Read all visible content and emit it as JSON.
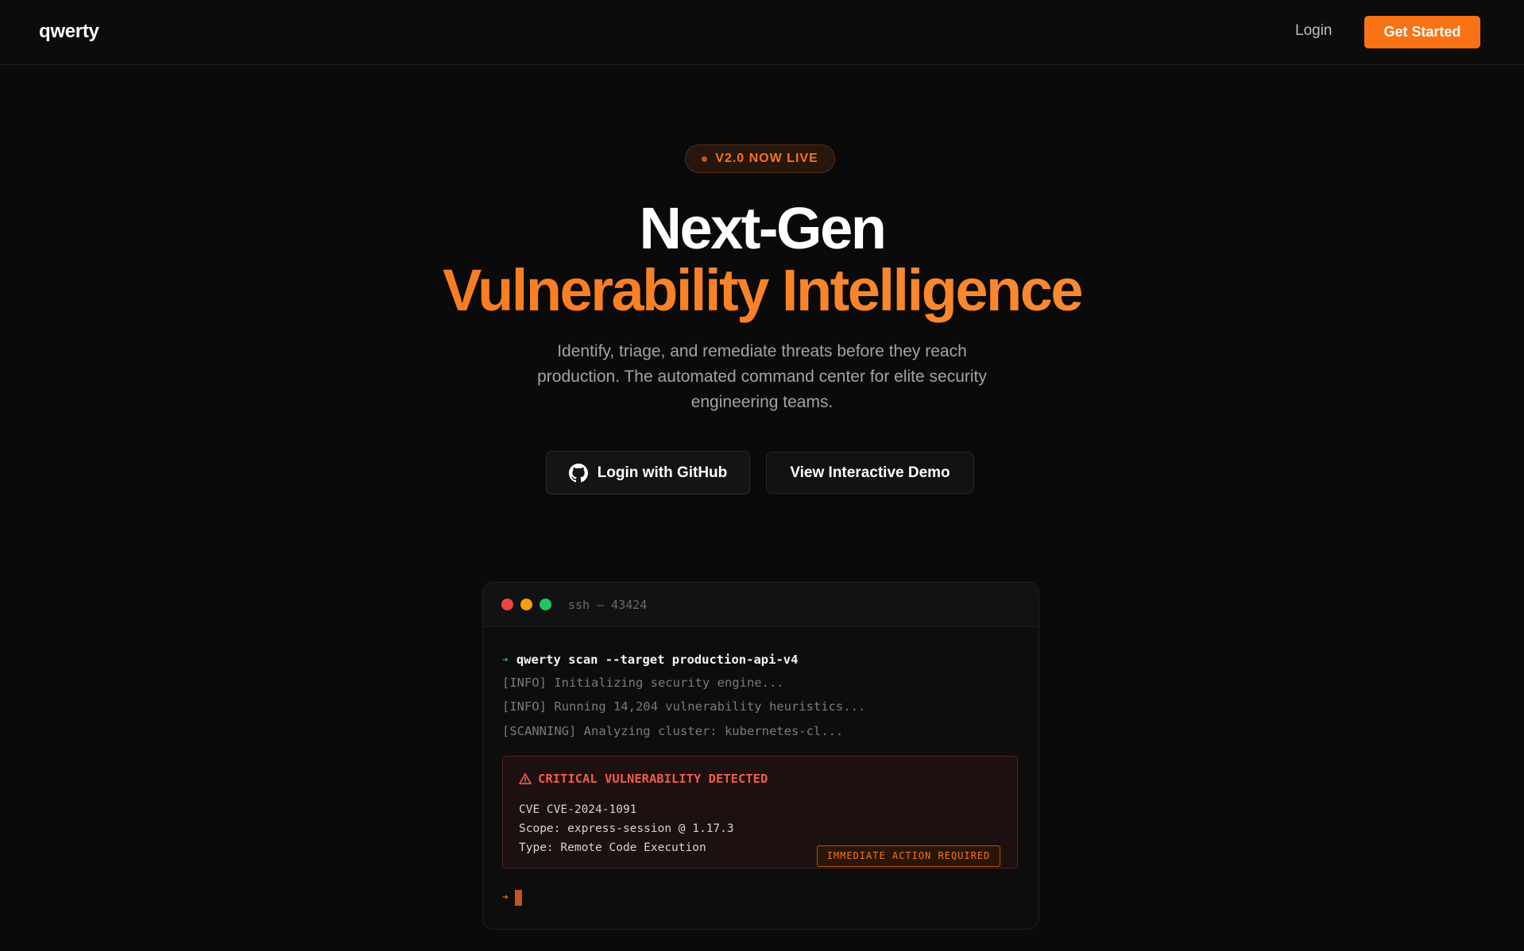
{
  "nav": {
    "logo": "qwerty",
    "login": "Login",
    "get_started": "Get Started"
  },
  "hero": {
    "badge": "V2.0 NOW LIVE",
    "title_line1": "Next-Gen",
    "title_line2": "Vulnerability Intelligence",
    "subtitle": "Identify, triage, and remediate threats before they reach production. The automated command center for elite security engineering teams.",
    "github_button": "Login with GitHub",
    "demo_button": "View Interactive Demo"
  },
  "terminal": {
    "title": "ssh — 43424",
    "prompt_symbol": "➔",
    "command": "qwerty scan --target production-api-v4",
    "logs": [
      "[INFO] Initializing security engine...",
      "[INFO] Running 14,204 vulnerability heuristics...",
      "[SCANNING] Analyzing cluster: kubernetes-cl..."
    ],
    "alert": {
      "title": "CRITICAL VULNERABILITY DETECTED",
      "lines": [
        "CVE CVE-2024-1091",
        "Scope: express-session @ 1.17.3",
        "Type: Remote Code Execution"
      ],
      "action": "IMMEDIATE ACTION REQUIRED"
    }
  },
  "colors": {
    "accent": "#f97316",
    "background": "#0a0a0a",
    "critical": "#ef5b4a",
    "success": "#22c55e"
  }
}
